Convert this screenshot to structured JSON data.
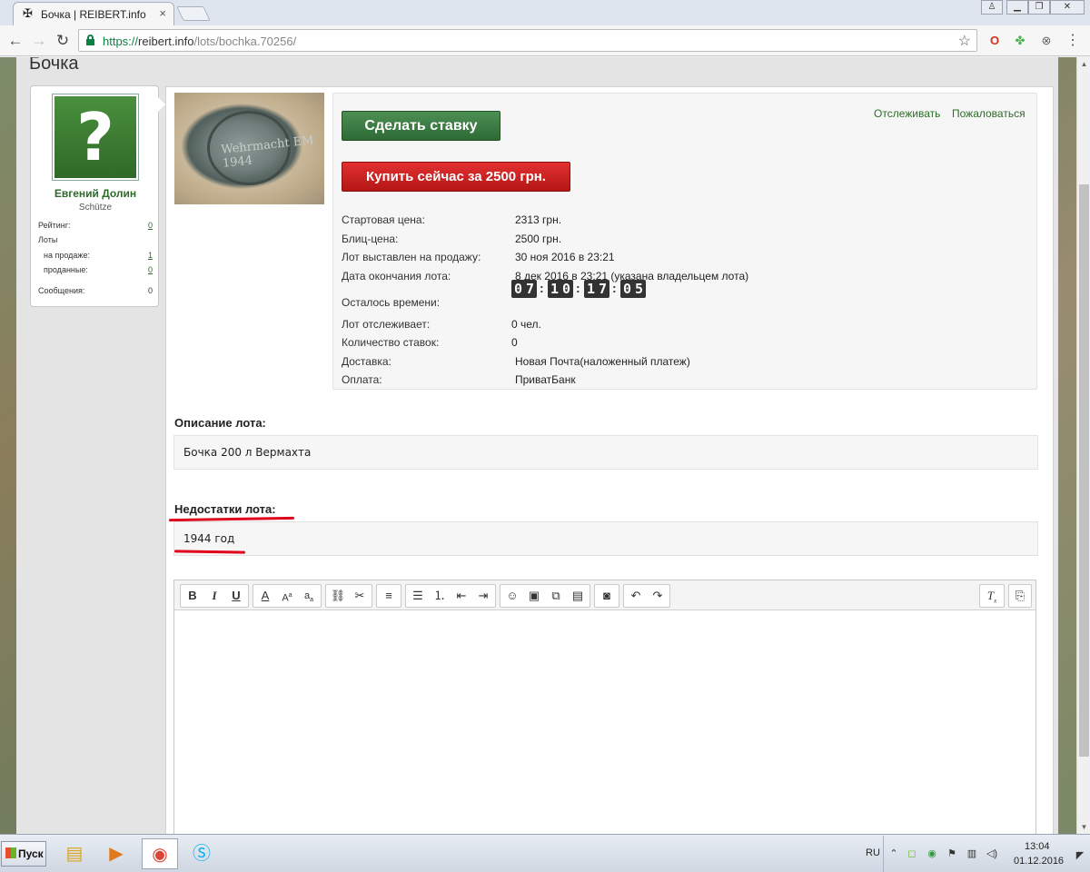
{
  "browser": {
    "tab_title": "Бочка | REIBERT.info",
    "tab_icon": "iron-cross-icon",
    "url_scheme": "https://",
    "url_host": "reibert.info",
    "url_path": "/lots/bochka.70256/"
  },
  "page": {
    "title": "Бочка"
  },
  "seller": {
    "name": "Евгений Долин",
    "rank": "Schütze",
    "avatar_glyph": "?",
    "rating_label": "Рейтинг:",
    "rating_value": "0",
    "lots_label": "Лоты",
    "on_sale_label": "на продаже:",
    "on_sale_value": "1",
    "sold_label": "проданные:",
    "sold_value": "0",
    "messages_label": "Сообщения:",
    "messages_value": "0"
  },
  "lot": {
    "image_text": "Wehrmacht EM 1944",
    "bid_button": "Сделать ставку",
    "buy_button": "Купить сейчас за 2500 грн.",
    "watch_link": "Отслеживать",
    "report_link": "Пожаловаться",
    "rows": [
      {
        "label": "Стартовая цена:",
        "value": "2313 грн."
      },
      {
        "label": "Блиц-цена:",
        "value": "2500 грн."
      },
      {
        "label": "Лот выставлен на продажу:",
        "value": "30 ноя 2016 в 23:21"
      },
      {
        "label": "Дата окончания лота:",
        "value": "8 дек 2016 в 23:21 (указана владельцем лота)"
      }
    ],
    "time_left_label": "Осталось времени:",
    "timer": {
      "days": "07",
      "hours": "10",
      "minutes": "17",
      "seconds": "05"
    },
    "rows2": [
      {
        "label": "Лот отслеживает:",
        "value": "0 чел."
      },
      {
        "label": "Количество ставок:",
        "value": "0"
      },
      {
        "label": "Доставка:",
        "value": "Новая Почта(наложенный платеж)"
      },
      {
        "label": "Оплата:",
        "value": "ПриватБанк"
      }
    ],
    "description_title": "Описание лота:",
    "description_text": "Бочка 200 л Вермахта",
    "defects_title": "Недостатки лота:",
    "defects_text": "1944 год",
    "annotation_color": "#e0001b"
  },
  "editor": {
    "buttons": [
      "bold",
      "italic",
      "underline",
      "text-color",
      "font-size",
      "font-family",
      "link",
      "unlink",
      "align",
      "bullet-list",
      "numbered-list",
      "outdent",
      "indent",
      "smiley",
      "image",
      "media",
      "code",
      "camera",
      "undo",
      "redo",
      "remove-format",
      "toggle-bbcode"
    ]
  },
  "taskbar": {
    "start_label": "Пуск",
    "language": "RU",
    "time": "13:04",
    "date": "01.12.2016"
  },
  "colors": {
    "accent_green": "#2e6b2a",
    "buy_red": "#c41f1f"
  }
}
